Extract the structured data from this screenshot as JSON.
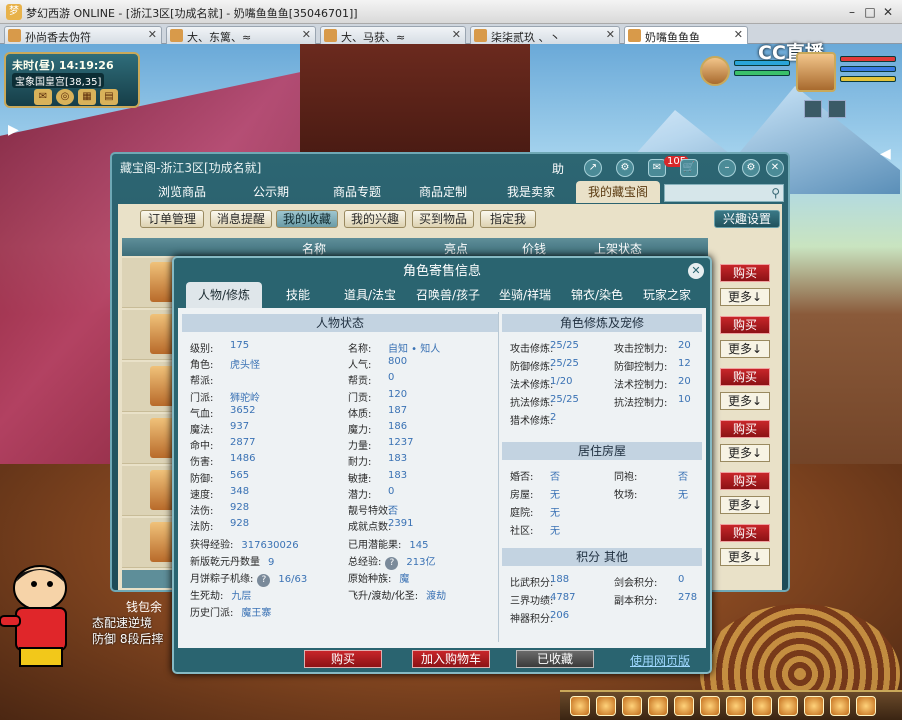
{
  "browser": {
    "title": "梦幻西游 ONLINE - [浙江3区[功成名就] - 奶嘴鱼鱼鱼[35046701]]",
    "tabs": [
      {
        "label": "孙尚香去伪符"
      },
      {
        "label": "大、东篱、≈"
      },
      {
        "label": "大、马获、≈"
      },
      {
        "label": "柒柒贰玖 、丶"
      },
      {
        "label": "奶嘴鱼鱼鱼"
      }
    ],
    "active_tab": 4
  },
  "overlay_logo": "CC直播",
  "hud": {
    "time": "未时(昼)  14:19:26",
    "location": "宝象国皇宫[38,35]"
  },
  "window": {
    "title": "藏宝阁-浙江3区[功成名就]",
    "help": "助",
    "cart_count": "105",
    "nav_tabs": [
      "浏览商品",
      "公示期",
      "商品专题",
      "商品定制",
      "我是卖家",
      "我的藏宝阁"
    ],
    "active_nav": 5,
    "sub_buttons": [
      "订单管理",
      "消息提醒",
      "我的收藏",
      "我的兴趣",
      "买到物品",
      "指定我"
    ],
    "active_sub": 2,
    "interest_settings": "兴趣设置",
    "columns": [
      "名称",
      "亮点",
      "价钱",
      "上架状态"
    ],
    "buy_label": "购买",
    "more_label": "更多↓",
    "wallet_label": "钱包余"
  },
  "popup": {
    "title": "角色寄售信息",
    "tabs": [
      "人物/修炼",
      "技能",
      "道具/法宝",
      "召唤兽/孩子",
      "坐骑/祥瑞",
      "锦衣/染色",
      "玩家之家"
    ],
    "active_tab": 0,
    "sections": {
      "status": "人物状态",
      "cultivation": "角色修炼及宠修",
      "house": "居住房屋",
      "score": "积分 其他"
    },
    "status_left": [
      {
        "k": "级别:",
        "v": "175"
      },
      {
        "k": "角色:",
        "v": "虎头怪"
      },
      {
        "k": "帮派:",
        "v": ""
      },
      {
        "k": "门派:",
        "v": "狮驼岭"
      },
      {
        "k": "气血:",
        "v": "3652"
      },
      {
        "k": "魔法:",
        "v": "937"
      },
      {
        "k": "命中:",
        "v": "2877"
      },
      {
        "k": "伤害:",
        "v": "1486"
      },
      {
        "k": "防御:",
        "v": "565"
      },
      {
        "k": "速度:",
        "v": "348"
      },
      {
        "k": "法伤:",
        "v": "928"
      },
      {
        "k": "法防:",
        "v": "928"
      }
    ],
    "status_right": [
      {
        "k": "名称:",
        "v": "自知 • 知人"
      },
      {
        "k": "人气:",
        "v": "800"
      },
      {
        "k": "帮贡:",
        "v": "0"
      },
      {
        "k": "门贡:",
        "v": "120"
      },
      {
        "k": "体质:",
        "v": "187"
      },
      {
        "k": "魔力:",
        "v": "186"
      },
      {
        "k": "力量:",
        "v": "1237"
      },
      {
        "k": "耐力:",
        "v": "183"
      },
      {
        "k": "敏捷:",
        "v": "183"
      },
      {
        "k": "潜力:",
        "v": "0"
      },
      {
        "k": "靓号特效:",
        "v": "否"
      },
      {
        "k": "成就点数:",
        "v": "2391"
      }
    ],
    "status_extra": [
      {
        "k": "获得经验:",
        "v": "317630026"
      },
      {
        "k": "已用潜能果:",
        "v": "145"
      },
      {
        "k": "新版乾元丹数量",
        "v": "9"
      },
      {
        "k": "总经验:",
        "v": "213亿"
      },
      {
        "k": "月饼粽子机缘:",
        "v": "16/63"
      },
      {
        "k": "原始种族:",
        "v": "魔"
      },
      {
        "k": "生死劫:",
        "v": "九层"
      },
      {
        "k": "飞升/渡劫/化圣:",
        "v": "渡劫"
      },
      {
        "k": "历史门派:",
        "v": "魔王寨"
      }
    ],
    "cultivation": [
      {
        "k": "攻击修炼:",
        "v": "25/25",
        "k2": "攻击控制力:",
        "v2": "20"
      },
      {
        "k": "防御修炼:",
        "v": "25/25",
        "k2": "防御控制力:",
        "v2": "12"
      },
      {
        "k": "法术修炼:",
        "v": "1/20",
        "k2": "法术控制力:",
        "v2": "20"
      },
      {
        "k": "抗法修炼:",
        "v": "25/25",
        "k2": "抗法控制力:",
        "v2": "10"
      },
      {
        "k": "猎术修炼:",
        "v": "2",
        "k2": "",
        "v2": ""
      }
    ],
    "house": [
      {
        "k": "婚否:",
        "v": "否",
        "k2": "同袍:",
        "v2": "否"
      },
      {
        "k": "房屋:",
        "v": "无",
        "k2": "牧场:",
        "v2": "无"
      },
      {
        "k": "庭院:",
        "v": "无",
        "k2": "",
        "v2": ""
      },
      {
        "k": "社区:",
        "v": "无",
        "k2": "",
        "v2": ""
      }
    ],
    "score": [
      {
        "k": "比武积分:",
        "v": "188",
        "k2": "剑会积分:",
        "v2": "0"
      },
      {
        "k": "三界功绩:",
        "v": "4787",
        "k2": "副本积分:",
        "v2": "278"
      },
      {
        "k": "神器积分:",
        "v": "206",
        "k2": "",
        "v2": ""
      }
    ],
    "buttons": {
      "buy": "购买",
      "add_cart": "加入购物车",
      "collected": "已收藏",
      "web": "使用网页版"
    }
  },
  "chat": {
    "line1": "态配速逆境",
    "line2": "防御 8段后摔"
  }
}
